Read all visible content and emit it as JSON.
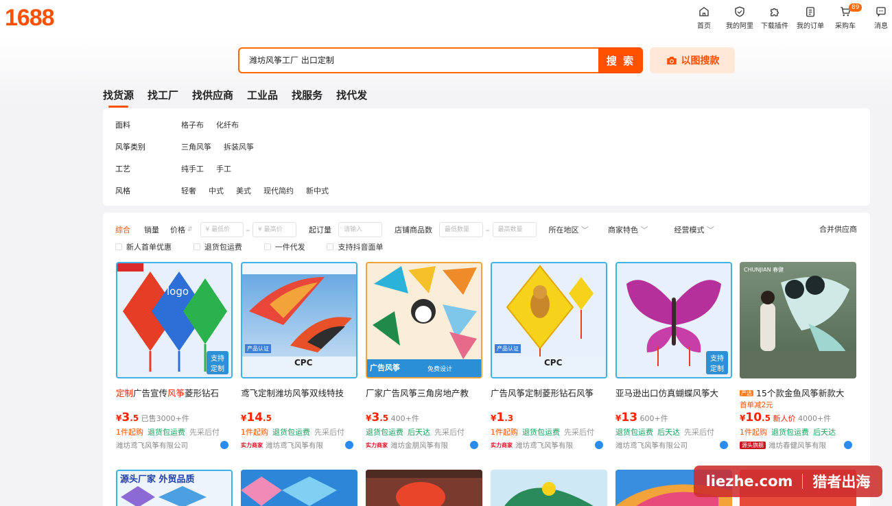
{
  "brand": {
    "logo": "1688",
    "color": "#ff5000"
  },
  "topnav": [
    {
      "label": "首页",
      "icon": "home-icon"
    },
    {
      "label": "我的阿里",
      "icon": "shield-user-icon"
    },
    {
      "label": "下载插件",
      "icon": "puzzle-icon"
    },
    {
      "label": "我的订单",
      "icon": "clipboard-icon"
    },
    {
      "label": "采购车",
      "icon": "cart-icon",
      "badge": "89"
    },
    {
      "label": "消息",
      "icon": "message-icon"
    }
  ],
  "search": {
    "value": "潍坊风筝工厂 出口定制",
    "button": "搜 索",
    "image_search": "以图搜款"
  },
  "tabs": [
    "找货源",
    "找工厂",
    "找供应商",
    "工业品",
    "找服务",
    "找代发"
  ],
  "attributes": [
    {
      "name": "面料",
      "values": [
        "格子布",
        "化纤布"
      ]
    },
    {
      "name": "风筝类别",
      "values": [
        "三角风筝",
        "拆装风筝"
      ]
    },
    {
      "name": "工艺",
      "values": [
        "纯手工",
        "手工"
      ]
    },
    {
      "name": "风格",
      "values": [
        "轻奢",
        "中式",
        "美式",
        "现代简约",
        "新中式"
      ]
    }
  ],
  "filters": {
    "sort_default": "综合",
    "sort_sales": "销量",
    "sort_price": "价格",
    "price_min_ph": "¥ 最低价",
    "dash": "–",
    "price_max_ph": "¥ 最高价",
    "moq_label": "起订量",
    "moq_ph": "请输入",
    "shop_count_label": "店铺商品数",
    "count_min_ph": "最低数量",
    "count_max_ph": "最高数量",
    "region": "所在地区",
    "merchant": "商家特色",
    "mode": "经营模式",
    "merge": "合并供应商",
    "checks": [
      "新人首单优惠",
      "退货包运费",
      "一件代发",
      "支持抖音面单"
    ]
  },
  "products": [
    {
      "title_hl": "定制",
      "title_a": "广告宣传",
      "title_hl2": "风筝",
      "title_b": "菱形钻石",
      "price_int": "3",
      "price_dec": ".5",
      "sold": "已售3000+件",
      "tags": [
        [
          "o",
          "1件起购"
        ],
        [
          "g",
          "退货包运费"
        ],
        [
          "gray",
          "先采后付"
        ]
      ],
      "shop_badge": "",
      "shop": "潍坊鸢飞风筝有限公司",
      "img_bg": "#e8f1fb",
      "img_labels": [
        "logo",
        "支持定制"
      ]
    },
    {
      "title_hl": "",
      "title_a": "鸢飞定制潍坊风筝双线特技",
      "title_hl2": "",
      "title_b": "",
      "price_int": "14",
      "price_dec": ".5",
      "sold": "",
      "tags": [
        [
          "o",
          "1件起购"
        ],
        [
          "g",
          "退货包运费"
        ],
        [
          "gray",
          "先采后付"
        ]
      ],
      "shop_badge": "实力商家",
      "shop": "潍坊鸢飞风筝有限",
      "img_bg": "#cfe3f5",
      "img_labels": [
        "产品认证",
        "CPC"
      ]
    },
    {
      "title_hl": "",
      "title_a": "厂家广告风筝三角房地产教",
      "title_hl2": "",
      "title_b": "",
      "price_int": "3",
      "price_dec": ".5",
      "sold": "400+件",
      "tags": [
        [
          "g",
          "退货包运费"
        ],
        [
          "g",
          "后天达"
        ],
        [
          "gray",
          "先采后付"
        ]
      ],
      "shop_badge": "实力商家",
      "shop": "潍坊金朋风筝有限",
      "img_bg": "#fbeed9",
      "img_labels": [
        "广告风筝",
        "免费设计"
      ]
    },
    {
      "title_hl": "",
      "title_a": "广告风筝定制菱形钻石风筝",
      "title_hl2": "",
      "title_b": "",
      "price_int": "1",
      "price_dec": ".3",
      "sold": "",
      "tags": [
        [
          "o",
          "1件起购"
        ],
        [
          "g",
          "退货包运费"
        ],
        [
          "gray",
          "先采后付"
        ]
      ],
      "shop_badge": "实力商家",
      "shop": "潍坊鸢飞风筝有限",
      "img_bg": "#e8f1fb",
      "img_labels": [
        "产品认证",
        "CPC"
      ]
    },
    {
      "title_hl": "",
      "title_a": "亚马逊出口仿真蝴蝶风筝大",
      "title_hl2": "",
      "title_b": "",
      "price_int": "13",
      "price_dec": "",
      "sold": "600+件",
      "tags": [
        [
          "g",
          "退货包运费"
        ],
        [
          "g",
          "后天达"
        ],
        [
          "gray",
          "先采后付"
        ]
      ],
      "shop_badge": "",
      "shop": "潍坊鸢飞风筝有限公司",
      "img_bg": "#e8f1fb",
      "img_labels": [
        "支持定制"
      ]
    },
    {
      "title_hl": "",
      "title_a": "15个款金鱼风筝新款大",
      "title_hl2": "",
      "title_b": "",
      "price_int": "10",
      "price_dec": ".5",
      "sold": "4000+件",
      "promo": "首单减2元",
      "newprice": "新人价",
      "tags": [
        [
          "o",
          "1件起购"
        ],
        [
          "g",
          "退货包运费"
        ],
        [
          "g",
          "后天达"
        ]
      ],
      "shop_badge": "源头旗舰",
      "shop": "潍坊春健风筝有限",
      "img_bg": "#6e8a6a",
      "img_labels": [
        "CHUNJIAN 春健"
      ],
      "title_badge": "严选"
    }
  ],
  "row2_banner": "源头厂家 外贸品质",
  "watermark": {
    "left": "liezhe.com",
    "right": "猎者出海"
  }
}
